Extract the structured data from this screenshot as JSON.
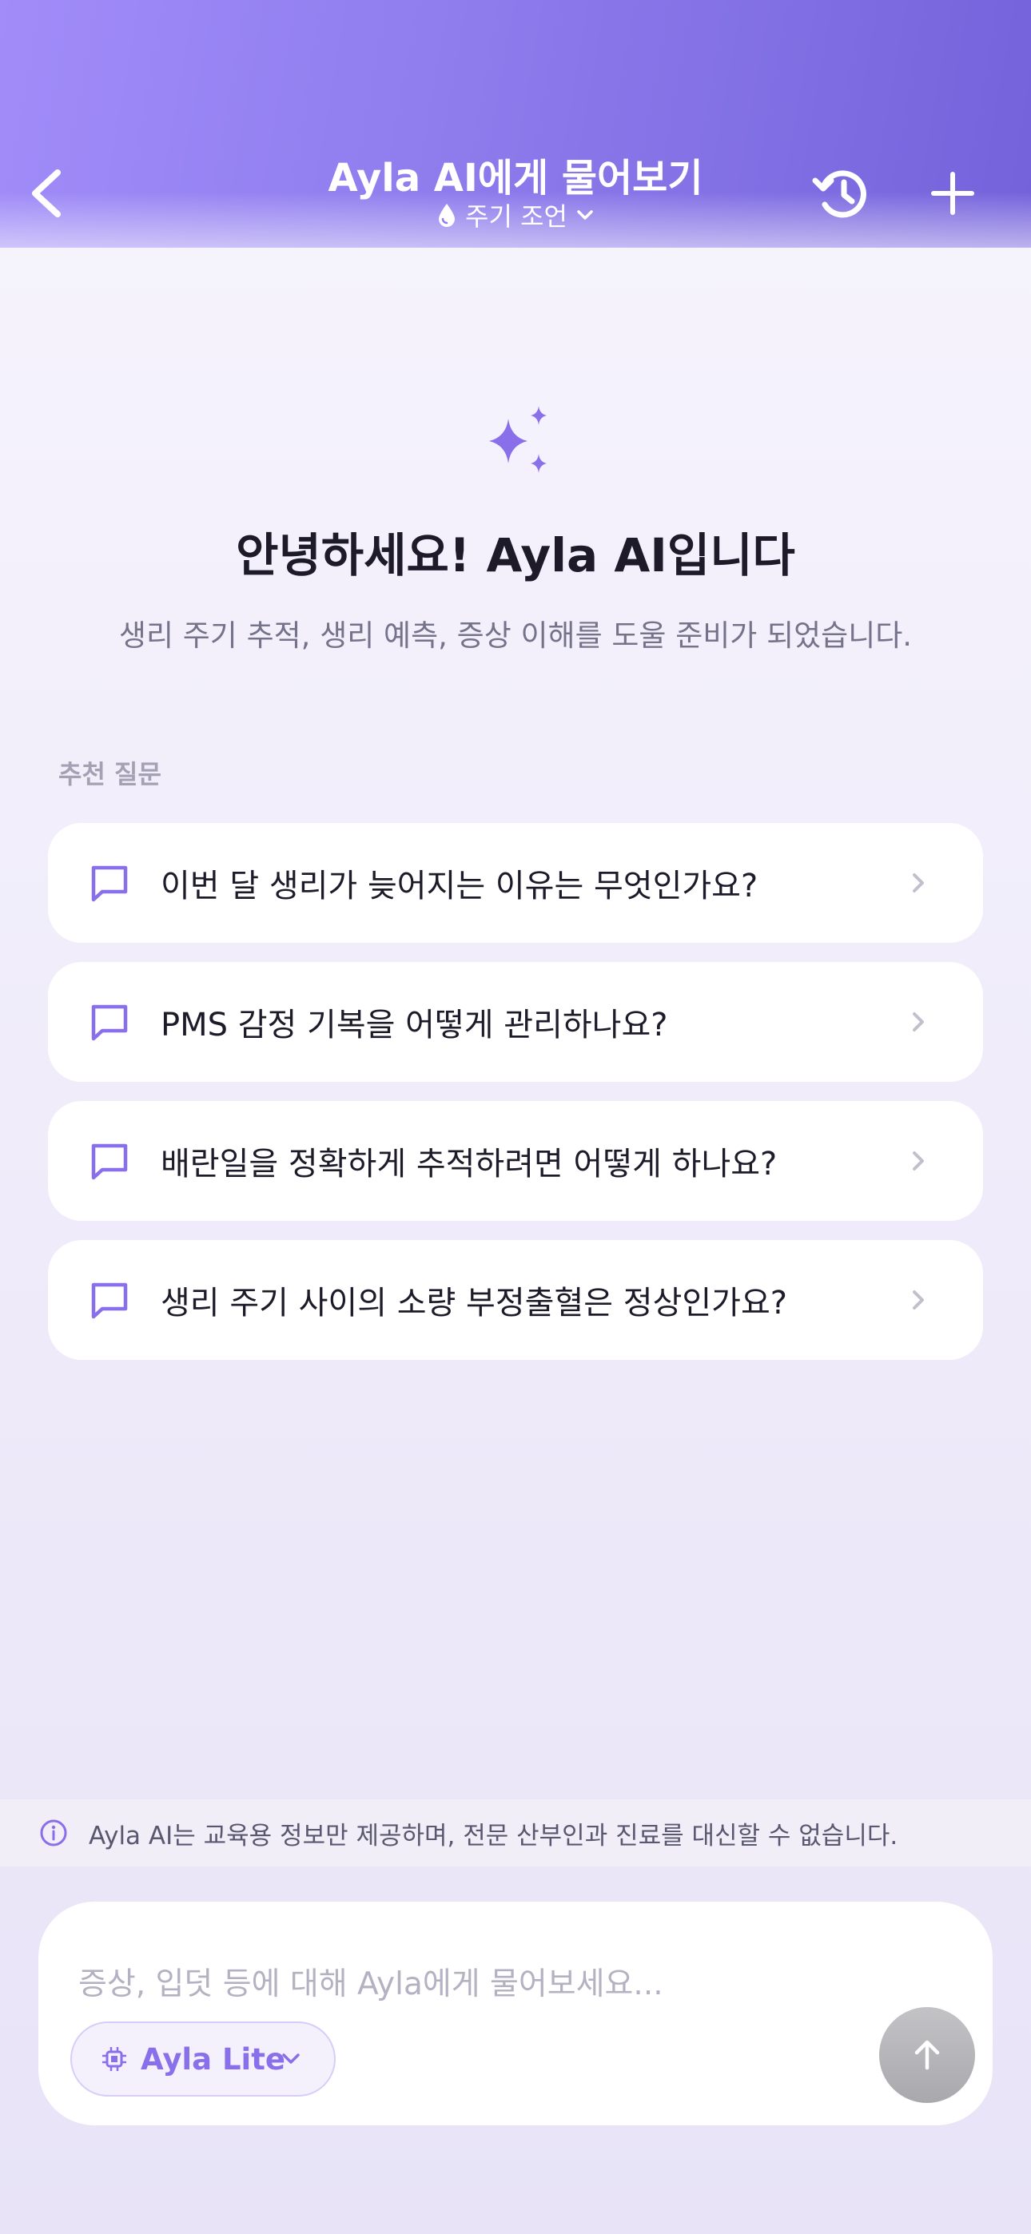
{
  "header": {
    "title": "Ayla AI에게 물어보기",
    "mode_label": "주기 조언"
  },
  "welcome": {
    "title": "안녕하세요! Ayla AI입니다",
    "subtitle": "생리 주기 추적, 생리 예측, 증상 이해를 도울 준비가 되었습니다."
  },
  "suggestions": {
    "label": "추천 질문",
    "items": [
      {
        "text": "이번 달 생리가 늦어지는 이유는 무엇인가요?"
      },
      {
        "text": "PMS 감정 기복을 어떻게 관리하나요?"
      },
      {
        "text": "배란일을 정확하게 추적하려면 어떻게 하나요?"
      },
      {
        "text": "생리 주기 사이의 소량 부정출혈은 정상인가요?"
      }
    ]
  },
  "disclaimer": {
    "text": "Ayla AI는 교육용 정보만 제공하며, 전문 산부인과 진료를 대신할 수 없습니다."
  },
  "composer": {
    "placeholder": "증상, 입덧 등에 대해 Ayla에게 물어보세요...",
    "model_label": "Ayla Lite"
  },
  "colors": {
    "accent": "#8a6fea",
    "header_start": "#a18cf9",
    "header_end": "#7462db",
    "send_disabled": "#b3b3b6"
  },
  "icons": {
    "back": "chevron-left-icon",
    "history": "history-icon",
    "new_chat": "plus-icon",
    "mode": "drop-icon",
    "hero": "sparkle-icon",
    "suggestion": "chat-bubble-icon",
    "disclaimer": "info-icon",
    "model": "chip-icon",
    "send": "arrow-up-icon"
  }
}
